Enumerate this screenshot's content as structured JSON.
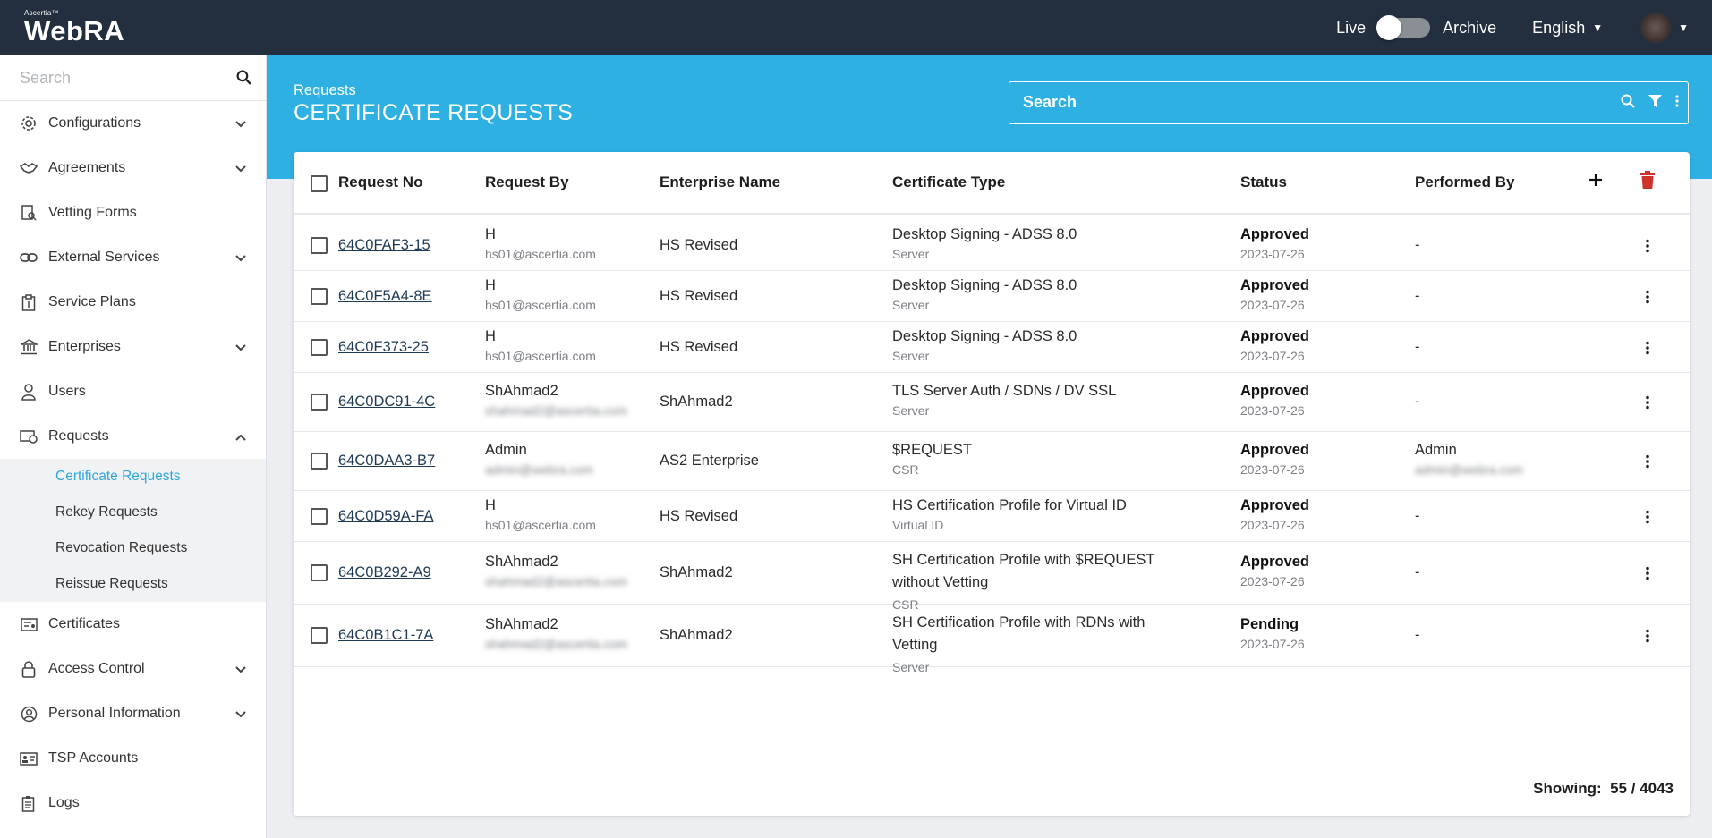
{
  "brand": {
    "small": "Ascertia™",
    "name": "WebRA"
  },
  "topbar": {
    "live_label": "Live",
    "archive_label": "Archive",
    "language": "English"
  },
  "sidebar": {
    "search_placeholder": "Search",
    "items": [
      {
        "label": "Configurations",
        "icon": "gear-icon",
        "has_children": true
      },
      {
        "label": "Agreements",
        "icon": "handshake-icon",
        "has_children": true
      },
      {
        "label": "Vetting Forms",
        "icon": "vetting-form-icon",
        "has_children": false
      },
      {
        "label": "External Services",
        "icon": "link-icon",
        "has_children": true
      },
      {
        "label": "Service Plans",
        "icon": "service-plan-icon",
        "has_children": false
      },
      {
        "label": "Enterprises",
        "icon": "bank-icon",
        "has_children": true
      },
      {
        "label": "Users",
        "icon": "user-icon",
        "has_children": false
      },
      {
        "label": "Requests",
        "icon": "requests-icon",
        "has_children": true,
        "expanded": true
      },
      {
        "label": "Certificates",
        "icon": "certificate-icon",
        "has_children": false
      },
      {
        "label": "Access Control",
        "icon": "lock-icon",
        "has_children": true
      },
      {
        "label": "Personal Information",
        "icon": "person-circle-icon",
        "has_children": true
      },
      {
        "label": "TSP Accounts",
        "icon": "id-card-icon",
        "has_children": false
      },
      {
        "label": "Logs",
        "icon": "log-icon",
        "has_children": false
      }
    ],
    "request_sub_items": [
      "Certificate Requests",
      "Rekey Requests",
      "Revocation Requests",
      "Reissue Requests"
    ],
    "active_sub_item": "Certificate Requests"
  },
  "header": {
    "breadcrumb": "Requests",
    "title": "CERTIFICATE REQUESTS",
    "search_placeholder": "Search"
  },
  "table": {
    "columns": [
      "Request No",
      "Request By",
      "Enterprise Name",
      "Certificate Type",
      "Status",
      "Performed By"
    ],
    "rows": [
      {
        "request_no": "64C0FAF3-15",
        "by_name": "H",
        "by_email": "hs01@ascertia.com",
        "by_blur": false,
        "enterprise": "HS Revised",
        "cert_type": "Desktop Signing - ADSS 8.0",
        "cert_sub": "Server",
        "status": "Approved",
        "date": "2023-07-26",
        "performed_by": "-",
        "performed_email": ""
      },
      {
        "request_no": "64C0F5A4-8E",
        "by_name": "H",
        "by_email": "hs01@ascertia.com",
        "by_blur": false,
        "enterprise": "HS Revised",
        "cert_type": "Desktop Signing - ADSS 8.0",
        "cert_sub": "Server",
        "status": "Approved",
        "date": "2023-07-26",
        "performed_by": "-",
        "performed_email": ""
      },
      {
        "request_no": "64C0F373-25",
        "by_name": "H",
        "by_email": "hs01@ascertia.com",
        "by_blur": false,
        "enterprise": "HS Revised",
        "cert_type": "Desktop Signing - ADSS 8.0",
        "cert_sub": "Server",
        "status": "Approved",
        "date": "2023-07-26",
        "performed_by": "-",
        "performed_email": ""
      },
      {
        "request_no": "64C0DC91-4C",
        "by_name": "ShAhmad2",
        "by_email": "shahmad2@ascertia.com",
        "by_blur": true,
        "enterprise": "ShAhmad2",
        "cert_type": "TLS Server Auth / SDNs / DV SSL",
        "cert_sub": "Server",
        "status": "Approved",
        "date": "2023-07-26",
        "performed_by": "-",
        "performed_email": ""
      },
      {
        "request_no": "64C0DAA3-B7",
        "by_name": "Admin",
        "by_email": "admin@webra.com",
        "by_blur": true,
        "enterprise": "AS2 Enterprise",
        "cert_type": "$REQUEST",
        "cert_sub": "CSR",
        "status": "Approved",
        "date": "2023-07-26",
        "performed_by": "Admin",
        "performed_email": "admin@webra.com"
      },
      {
        "request_no": "64C0D59A-FA",
        "by_name": "H",
        "by_email": "hs01@ascertia.com",
        "by_blur": false,
        "enterprise": "HS Revised",
        "cert_type": "HS Certification Profile for Virtual ID",
        "cert_sub": "Virtual ID",
        "status": "Approved",
        "date": "2023-07-26",
        "performed_by": "-",
        "performed_email": ""
      },
      {
        "request_no": "64C0B292-A9",
        "by_name": "ShAhmad2",
        "by_email": "shahmad2@ascertia.com",
        "by_blur": true,
        "enterprise": "ShAhmad2",
        "cert_type": "SH Certification Profile with $REQUEST without Vetting",
        "cert_sub": "CSR",
        "status": "Approved",
        "date": "2023-07-26",
        "performed_by": "-",
        "performed_email": ""
      },
      {
        "request_no": "64C0B1C1-7A",
        "by_name": "ShAhmad2",
        "by_email": "shahmad2@ascertia.com",
        "by_blur": true,
        "enterprise": "ShAhmad2",
        "cert_type": "SH Certification Profile with RDNs with Vetting",
        "cert_sub": "Server",
        "status": "Pending",
        "date": "2023-07-26",
        "performed_by": "-",
        "performed_email": ""
      }
    ]
  },
  "footer": {
    "showing_label": "Showing:",
    "showing_value": "55 / 4043"
  },
  "colors": {
    "topbar": "#232f3e",
    "header_blue": "#2eb0e2",
    "active_link": "#2ea6da",
    "delete_red": "#d0312d"
  }
}
